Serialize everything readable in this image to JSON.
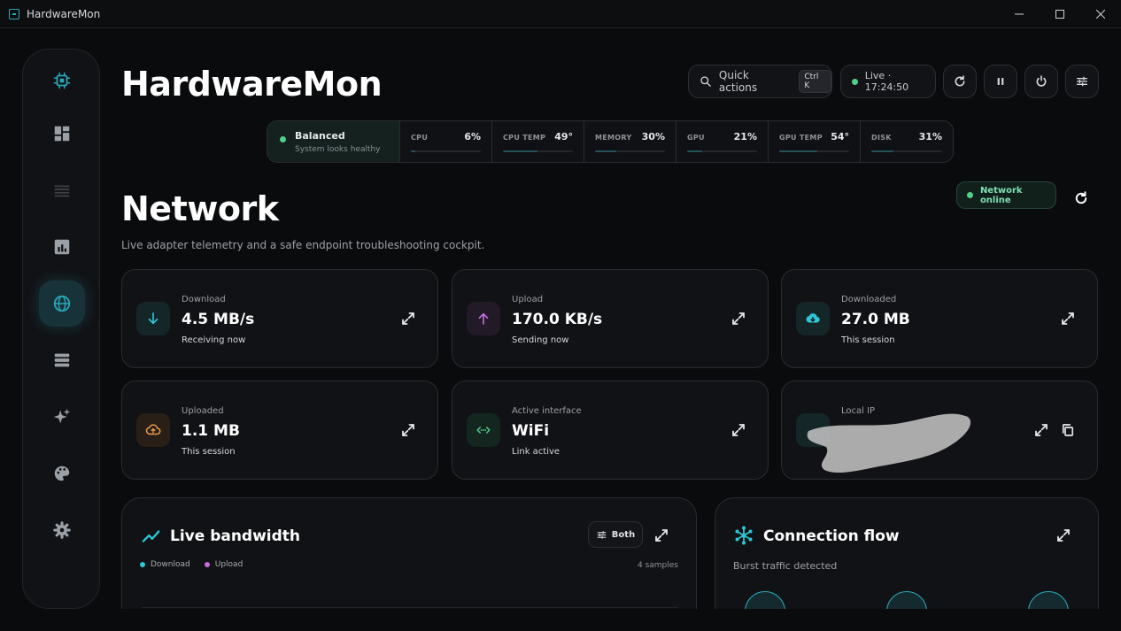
{
  "window": {
    "title": "HardwareMon"
  },
  "sidebar": {
    "items": [
      {
        "name": "cpu",
        "icon": "cpu-icon",
        "active": false
      },
      {
        "name": "dashboard",
        "icon": "dashboard-icon",
        "active": false
      },
      {
        "name": "list",
        "icon": "list-icon",
        "active": false
      },
      {
        "name": "charts",
        "icon": "chart-icon",
        "active": false
      },
      {
        "name": "network",
        "icon": "globe-icon",
        "active": true
      },
      {
        "name": "storage",
        "icon": "storage-icon",
        "active": false
      },
      {
        "name": "sparkles",
        "icon": "sparkles-icon",
        "active": false
      },
      {
        "name": "themes",
        "icon": "palette-icon",
        "active": false
      },
      {
        "name": "settings",
        "icon": "gear-icon",
        "active": false
      }
    ]
  },
  "header": {
    "title": "HardwareMon",
    "quick_actions": "Quick actions",
    "shortcut": "Ctrl K",
    "live": "Live · 17:24:50"
  },
  "status": {
    "profile": "Balanced",
    "profile_desc": "System looks healthy",
    "metrics": [
      {
        "label": "CPU",
        "value": "6%",
        "percent": 6
      },
      {
        "label": "CPU TEMP",
        "value": "49°",
        "percent": 49
      },
      {
        "label": "MEMORY",
        "value": "30%",
        "percent": 30
      },
      {
        "label": "GPU",
        "value": "21%",
        "percent": 21
      },
      {
        "label": "GPU TEMP",
        "value": "54°",
        "percent": 54
      },
      {
        "label": "DISK",
        "value": "31%",
        "percent": 31
      }
    ]
  },
  "page": {
    "title": "Network",
    "subtitle": "Live adapter telemetry and a safe endpoint troubleshooting cockpit.",
    "online_badge": "Network online"
  },
  "cards": [
    {
      "label": "Download",
      "value": "4.5 MB/s",
      "sub": "Receiving now",
      "icon": "arrow-down-icon",
      "color": "#2fc6d6"
    },
    {
      "label": "Upload",
      "value": "170.0 KB/s",
      "sub": "Sending now",
      "icon": "arrow-up-icon",
      "color": "#c86adb"
    },
    {
      "label": "Downloaded",
      "value": "27.0 MB",
      "sub": "This session",
      "icon": "cloud-download-icon",
      "color": "#2fc6d6"
    },
    {
      "label": "Uploaded",
      "value": "1.1 MB",
      "sub": "This session",
      "icon": "cloud-upload-icon",
      "color": "#e89a4a"
    },
    {
      "label": "Active interface",
      "value": "WiFi",
      "sub": "Link active",
      "icon": "interface-icon",
      "color": "#4fd18b"
    },
    {
      "label": "Local IP",
      "value": "",
      "sub": "",
      "icon": "ip-icon",
      "color": "#2fc6d6"
    }
  ],
  "bandwidth": {
    "title": "Live bandwidth",
    "filter": "Both",
    "legend": [
      "Download",
      "Upload"
    ],
    "samples": "4 samples"
  },
  "flow": {
    "title": "Connection flow",
    "subtitle": "Burst traffic detected"
  },
  "colors": {
    "accent": "#2aa6b8",
    "online": "#4fd18b",
    "download": "#2fc6d6",
    "upload": "#c86adb"
  }
}
